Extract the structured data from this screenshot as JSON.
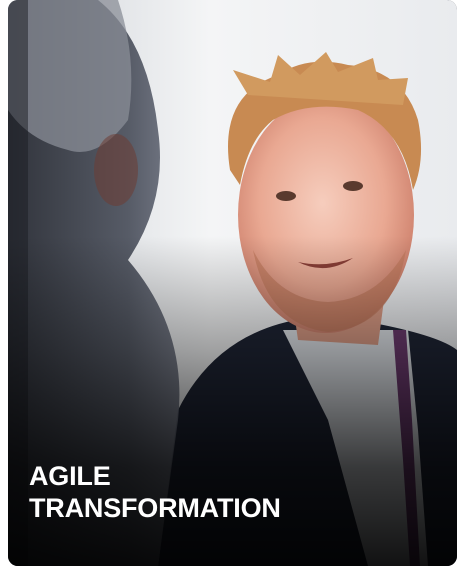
{
  "card": {
    "title_lines": [
      "AGILE",
      "TRANSFORMATION"
    ]
  },
  "photo": {
    "subject": "portrait-photo",
    "colors": {
      "background_light": "#eef0f2",
      "skin": "#e7a893",
      "hair": "#c9874e",
      "jacket": "#1d2433",
      "foreground_person": "#3b3f4a"
    }
  }
}
